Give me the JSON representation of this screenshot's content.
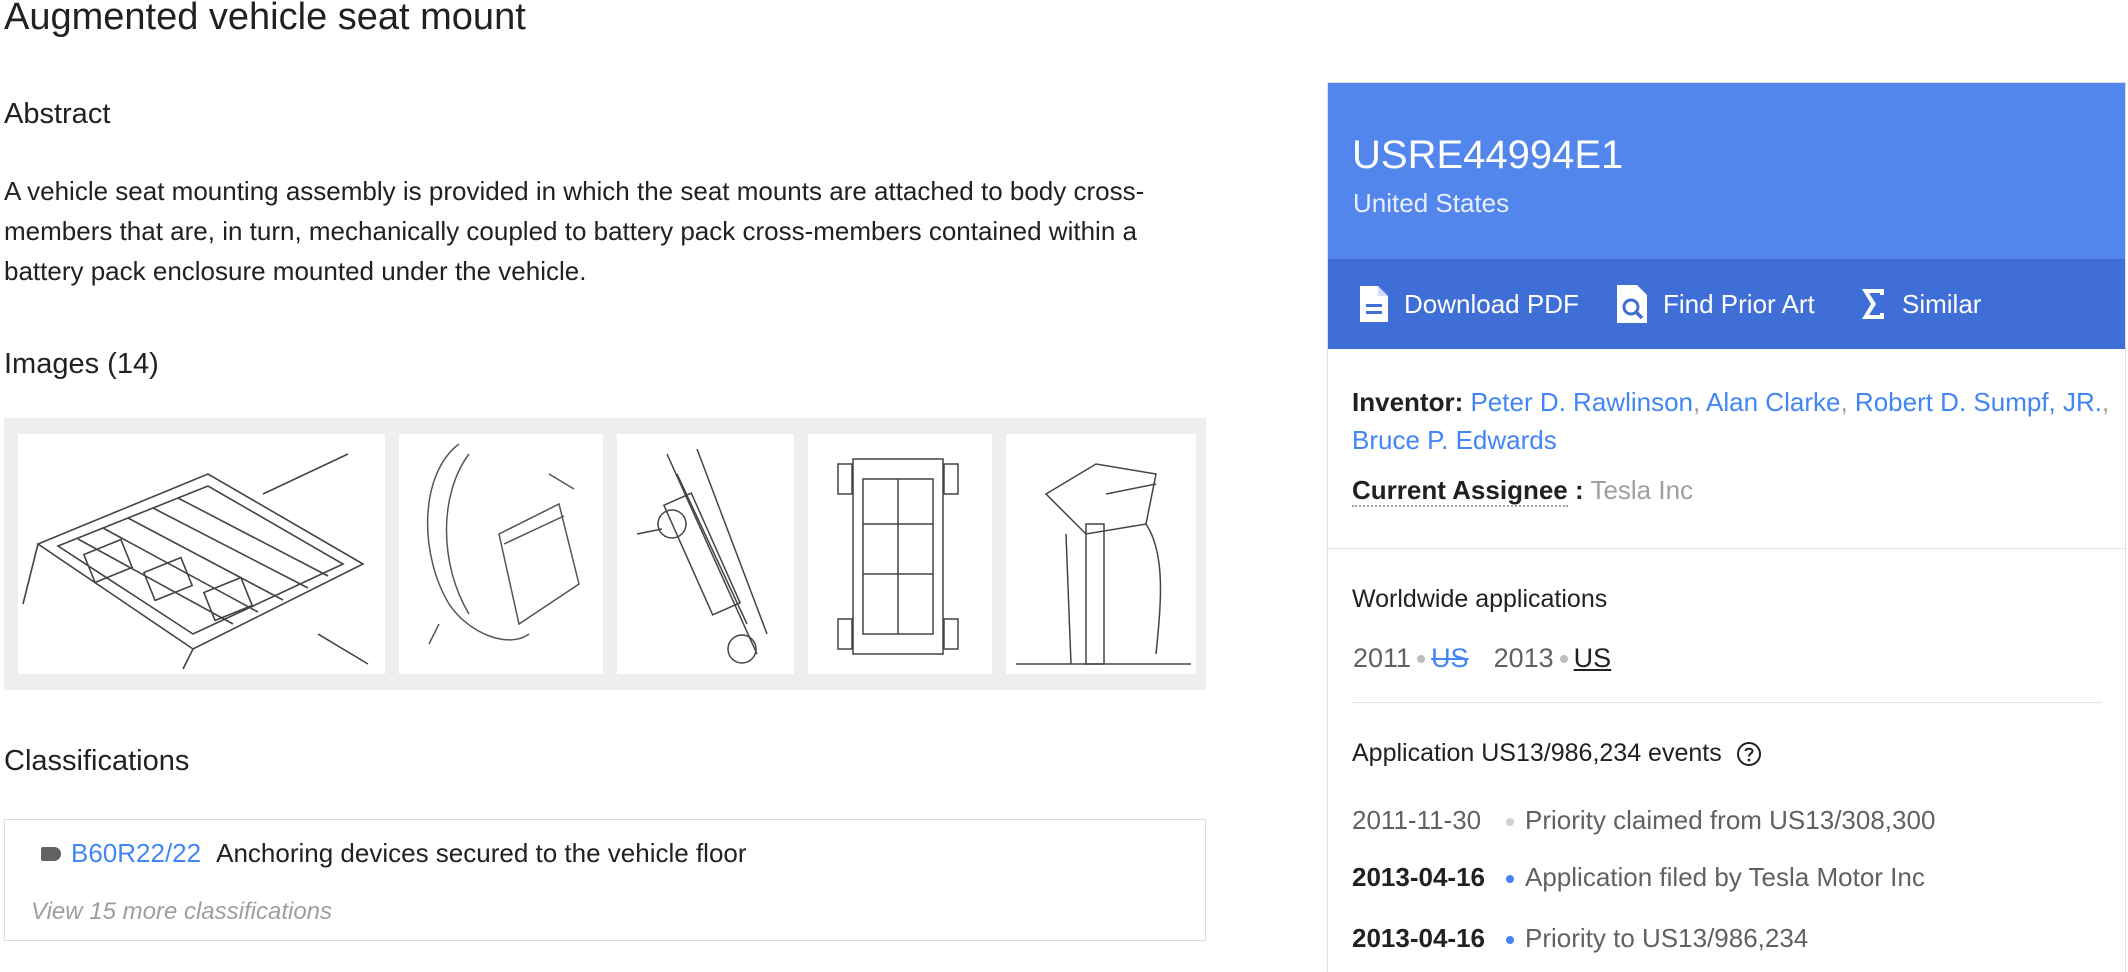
{
  "title": "Augmented vehicle seat mount",
  "abstract": {
    "heading": "Abstract",
    "text": "A vehicle seat mounting assembly is provided in which the seat mounts are attached to body cross-members that are, in turn, mechanically coupled to battery pack cross-members contained within a battery pack enclosure mounted under the vehicle."
  },
  "images": {
    "heading": "Images (14)"
  },
  "classifications": {
    "heading": "Classifications",
    "code": "B60R22/22",
    "description": "Anchoring devices secured to the vehicle floor",
    "more": "View 15 more classifications"
  },
  "sidebar": {
    "pub_number": "USRE44994E1",
    "country": "United States",
    "actions": {
      "download": "Download PDF",
      "prior_art": "Find Prior Art",
      "similar": "Similar"
    },
    "inventor_label": "Inventor:",
    "inventors": [
      "Peter D. Rawlinson",
      "Alan Clarke",
      "Robert D. Sumpf, JR.",
      "Bruce P. Edwards"
    ],
    "inventor_separator": ",",
    "assignee_label": "Current Assignee",
    "assignee_colon": ":",
    "assignee": "Tesla Inc",
    "worldwide": {
      "heading": "Worldwide applications",
      "entries": [
        {
          "year": "2011",
          "country": "US"
        },
        {
          "year": "2013",
          "country": "US"
        }
      ]
    },
    "events": {
      "heading": "Application US13/986,234 events",
      "items": [
        {
          "date": "2011-11-30",
          "text": "Priority claimed from US13/308,300"
        },
        {
          "date": "2013-04-16",
          "text": "Application filed by Tesla Motor Inc"
        },
        {
          "date": "2013-04-16",
          "text": "Priority to US13/986,234"
        }
      ]
    }
  },
  "colors": {
    "link": "#4285f4",
    "header": "#5286ec",
    "action_bar": "#3f6fd6"
  }
}
